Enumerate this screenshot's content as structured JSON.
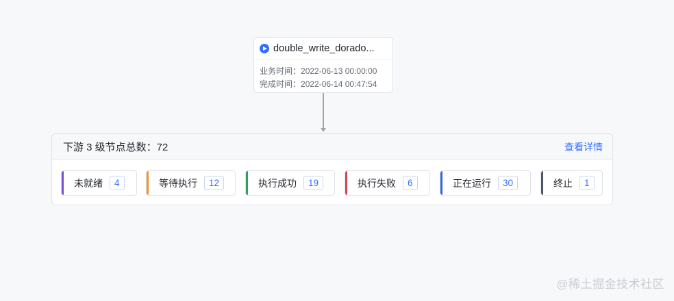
{
  "task": {
    "name": "double_write_dorado...",
    "business_time_label": "业务时间：",
    "business_time": "2022-06-13 00:00:00",
    "finish_time_label": "完成时间：",
    "finish_time": "2022-06-14 00:47:54"
  },
  "downstream": {
    "title": "下游 3 级节点总数：72",
    "details_link": "查看详情",
    "statuses": [
      {
        "label": "未就绪",
        "count": "4",
        "color": "#7b4fdc"
      },
      {
        "label": "等待执行",
        "count": "12",
        "color": "#f0962c"
      },
      {
        "label": "执行成功",
        "count": "19",
        "color": "#27a35a"
      },
      {
        "label": "执行失败",
        "count": "6",
        "color": "#d6434a"
      },
      {
        "label": "正在运行",
        "count": "30",
        "color": "#3366e0"
      },
      {
        "label": "终止",
        "count": "1",
        "color": "#4d5566"
      }
    ]
  },
  "watermark": "@稀土掘金技术社区"
}
